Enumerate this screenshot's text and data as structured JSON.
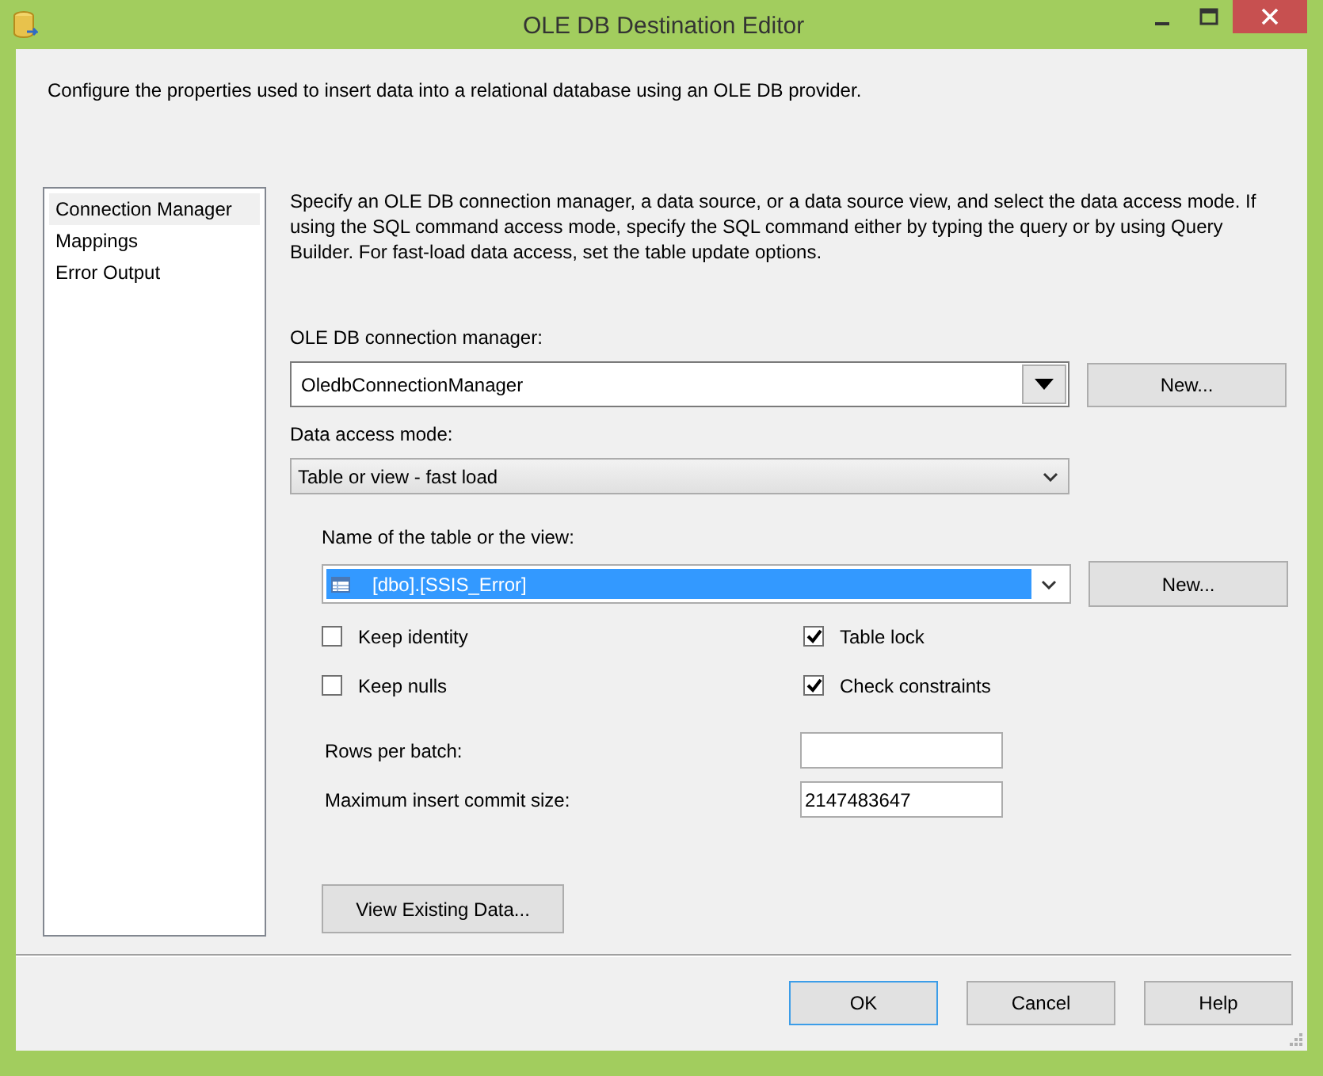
{
  "window": {
    "title": "OLE DB Destination Editor"
  },
  "description": "Configure the properties used to insert data into a relational database using an OLE DB provider.",
  "sidebar": {
    "items": [
      {
        "label": "Connection Manager",
        "selected": true
      },
      {
        "label": "Mappings",
        "selected": false
      },
      {
        "label": "Error Output",
        "selected": false
      }
    ]
  },
  "instructions": "Specify an OLE DB connection manager, a data source, or a data source view, and select the data access mode. If using the SQL command access mode, specify the SQL command either by typing the query or by using Query Builder. For fast-load data access, set the table update options.",
  "connection_manager": {
    "label": "OLE DB connection manager:",
    "value": "OledbConnectionManager",
    "button": "New..."
  },
  "access_mode": {
    "label": "Data access mode:",
    "value": "Table or view - fast load"
  },
  "table_name": {
    "label": "Name of the table or the view:",
    "value": "[dbo].[SSIS_Error]",
    "selected": true,
    "button": "New..."
  },
  "options": [
    {
      "label": "Keep identity",
      "checked": false
    },
    {
      "label": "Table lock",
      "checked": true
    },
    {
      "label": "Keep nulls",
      "checked": false
    },
    {
      "label": "Check constraints",
      "checked": true
    }
  ],
  "fields": [
    {
      "label": "Rows per batch:"
    },
    {
      "label": "Maximum insert commit size:",
      "value": "2147483647"
    }
  ],
  "view_button": "View Existing Data...",
  "buttons": [
    {
      "label": "OK",
      "focused": true
    },
    {
      "label": "Cancel",
      "focused": false
    },
    {
      "label": "Help",
      "focused": false
    }
  ]
}
